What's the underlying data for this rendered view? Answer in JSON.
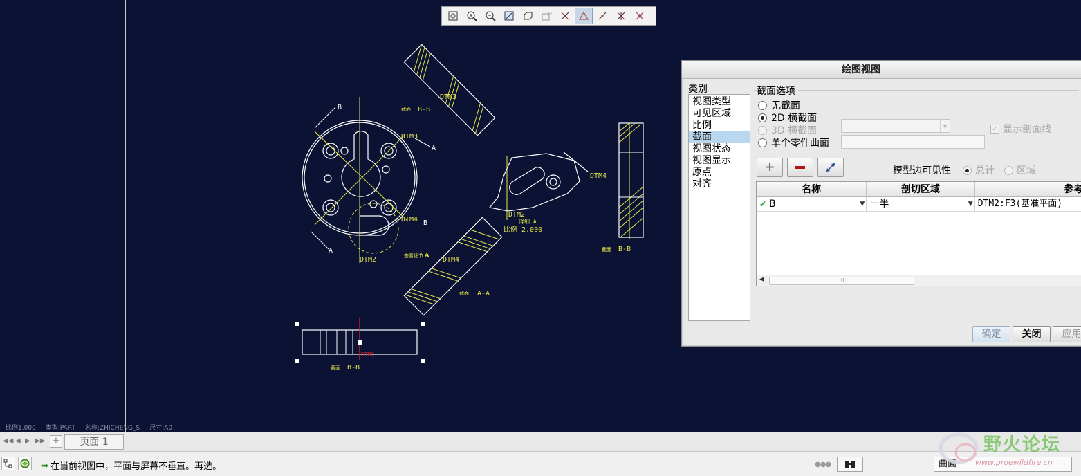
{
  "canvas": {
    "background": "#0b1233",
    "line_color": "#ffffff",
    "annotation_color": "#e8e84a",
    "status": {
      "scale": "比例1.000",
      "type": "类型:PART",
      "name": "名称:ZHICHENG_S",
      "size": "尺寸:A0"
    },
    "labels": {
      "bb_top": "B-B",
      "bb_right": "B-B",
      "bb_bottom": "B-B",
      "aa": "A-A",
      "section_tag": "截面",
      "detail_a": "详细 A",
      "detail_scale": "比例 2.000",
      "detail_circle": "查看细节 A",
      "dtm2": "DTM2",
      "dtm3": "DTM3",
      "dtm4": "DTM4",
      "b": "B",
      "a": "A"
    }
  },
  "toolbar": {
    "buttons": [
      {
        "name": "refit-icon"
      },
      {
        "name": "zoom-in-icon"
      },
      {
        "name": "zoom-out-icon"
      },
      {
        "name": "repaint-icon"
      },
      {
        "name": "display-style-icon"
      },
      {
        "name": "annotation-display-icon"
      },
      {
        "name": "datum-display-icon"
      },
      {
        "name": "sketch-filter-icon"
      },
      {
        "name": "point-display-icon"
      },
      {
        "name": "csys-display-icon"
      },
      {
        "name": "spin-center-icon"
      }
    ]
  },
  "dialog": {
    "title": "绘图视图",
    "category_label": "类别",
    "categories": [
      "视图类型",
      "可见区域",
      "比例",
      "截面",
      "视图状态",
      "视图显示",
      "原点",
      "对齐"
    ],
    "selected_category": "截面",
    "section_options_label": "截面选项",
    "options": {
      "no_section": "无截面",
      "xsec_2d": "2D 横截面",
      "xsec_3d": "3D 横截面",
      "single_part_surface": "单个零件曲面"
    },
    "show_hatch": "显示剖面线",
    "model_edge_visibility": "模型边可见性",
    "vis_total": "总计",
    "vis_area": "区域",
    "table": {
      "headers": [
        "名称",
        "剖切区域",
        "参考"
      ],
      "rows": [
        {
          "name": "B",
          "region": "一半",
          "reference": "DTM2:F3(基准平面)"
        }
      ],
      "scroll_thumb": "III"
    },
    "buttons": {
      "ok": "确定",
      "close": "关闭",
      "apply": "应用"
    }
  },
  "page_bar": {
    "add": "+",
    "page_tab": "页面 1"
  },
  "status_bar": {
    "message": "在当前视图中，平面与屏幕不垂直。再选。",
    "filter": "曲面"
  },
  "watermark": {
    "title": "野火论坛",
    "url": "www.proewildfire.cn"
  }
}
